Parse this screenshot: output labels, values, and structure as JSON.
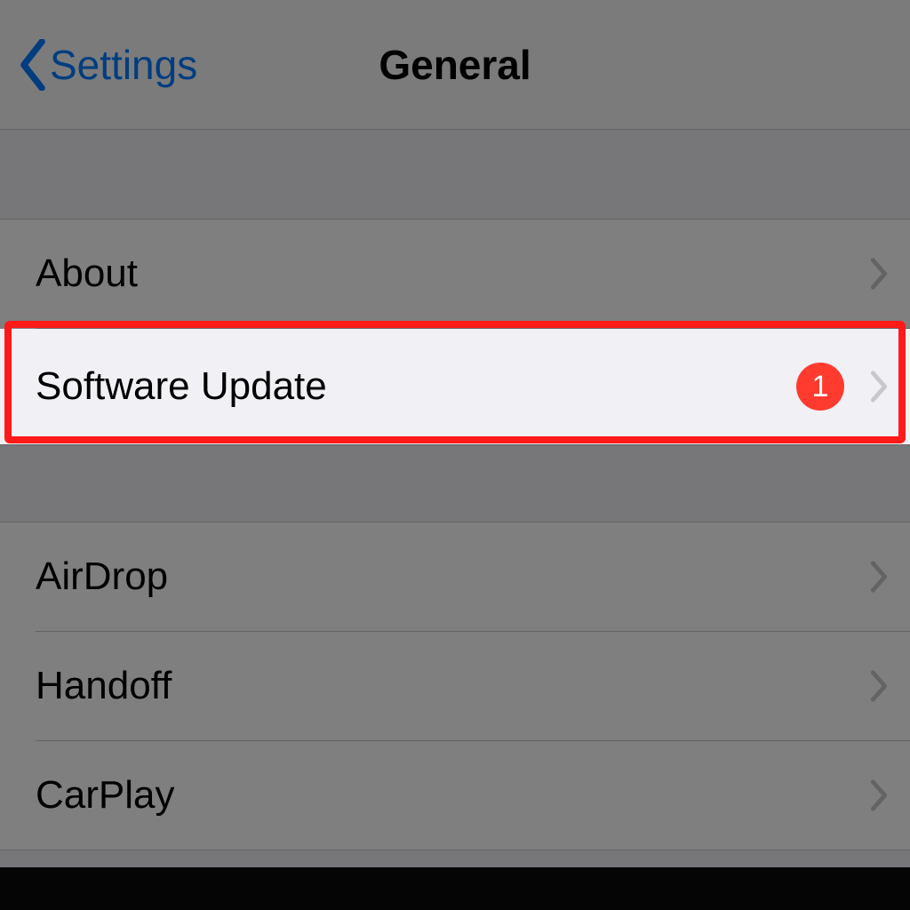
{
  "nav": {
    "back_label": "Settings",
    "title": "General"
  },
  "section1": {
    "items": [
      {
        "label": "About"
      },
      {
        "label": "Software Update",
        "badge": "1"
      }
    ]
  },
  "section2": {
    "items": [
      {
        "label": "AirDrop"
      },
      {
        "label": "Handoff"
      },
      {
        "label": "CarPlay"
      }
    ]
  },
  "colors": {
    "link": "#007aff",
    "badge": "#ff3b30",
    "highlight_border": "#ff1a1a"
  }
}
